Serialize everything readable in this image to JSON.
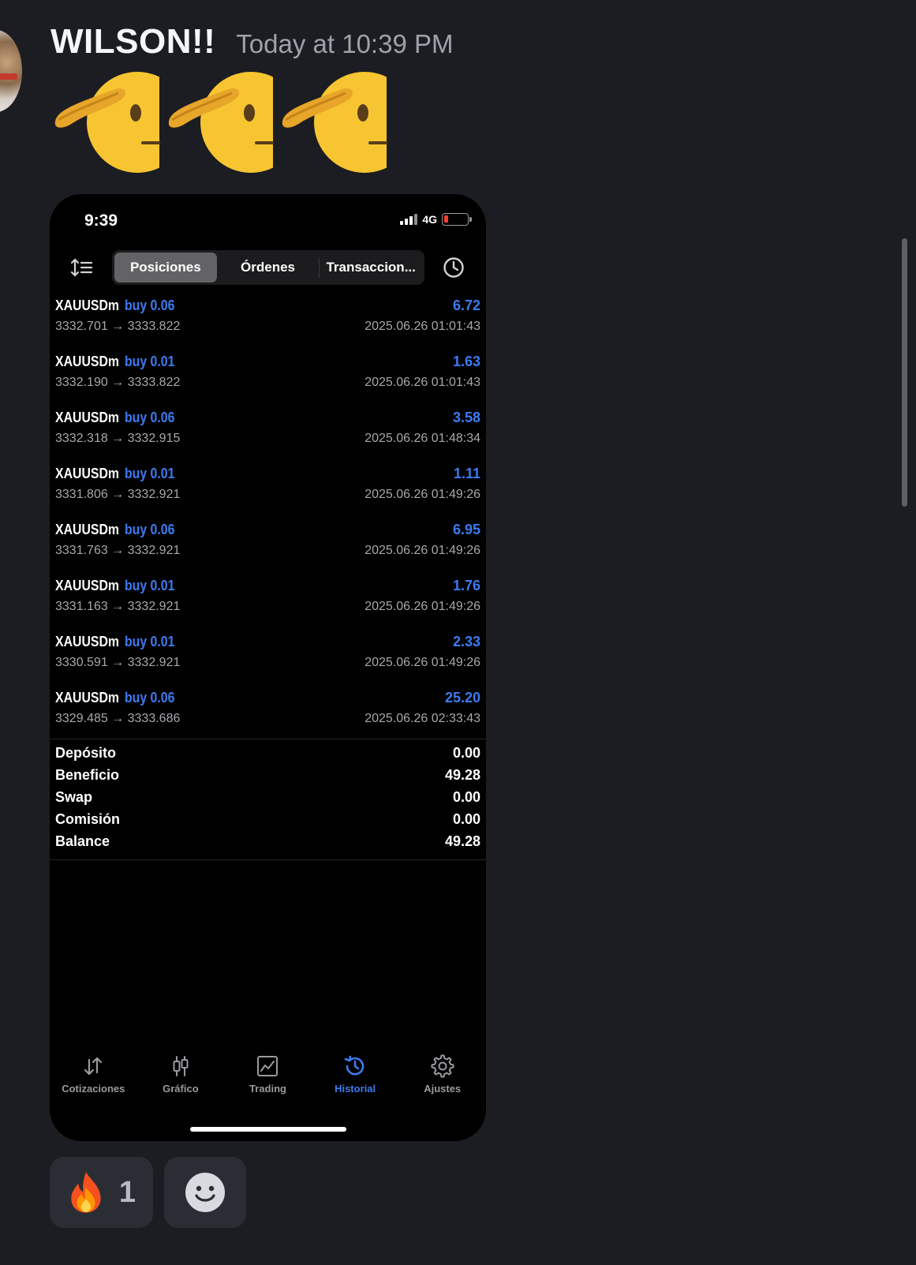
{
  "message": {
    "username": "WILSON!!",
    "timestamp": "Today at 10:39 PM",
    "emoji_count": 3
  },
  "phone": {
    "status_time": "9:39",
    "network": "4G",
    "segments": [
      "Posiciones",
      "Órdenes",
      "Transaccion..."
    ],
    "active_segment": "Posiciones",
    "trades": [
      {
        "symbol": "XAUUSDm",
        "side": "buy 0.06",
        "profit": "6.72",
        "prices": "3332.701 → 3333.822",
        "date": "2025.06.26 01:01:43"
      },
      {
        "symbol": "XAUUSDm",
        "side": "buy 0.01",
        "profit": "1.63",
        "prices": "3332.190 → 3333.822",
        "date": "2025.06.26 01:01:43"
      },
      {
        "symbol": "XAUUSDm",
        "side": "buy 0.06",
        "profit": "3.58",
        "prices": "3332.318 → 3332.915",
        "date": "2025.06.26 01:48:34"
      },
      {
        "symbol": "XAUUSDm",
        "side": "buy 0.01",
        "profit": "1.11",
        "prices": "3331.806 → 3332.921",
        "date": "2025.06.26 01:49:26"
      },
      {
        "symbol": "XAUUSDm",
        "side": "buy 0.06",
        "profit": "6.95",
        "prices": "3331.763 → 3332.921",
        "date": "2025.06.26 01:49:26"
      },
      {
        "symbol": "XAUUSDm",
        "side": "buy 0.01",
        "profit": "1.76",
        "prices": "3331.163 → 3332.921",
        "date": "2025.06.26 01:49:26"
      },
      {
        "symbol": "XAUUSDm",
        "side": "buy 0.01",
        "profit": "2.33",
        "prices": "3330.591 → 3332.921",
        "date": "2025.06.26 01:49:26"
      },
      {
        "symbol": "XAUUSDm",
        "side": "buy 0.06",
        "profit": "25.20",
        "prices": "3329.485 → 3333.686",
        "date": "2025.06.26 02:33:43"
      }
    ],
    "summary": [
      {
        "label": "Depósito",
        "value": "0.00"
      },
      {
        "label": "Beneficio",
        "value": "49.28"
      },
      {
        "label": "Swap",
        "value": "0.00"
      },
      {
        "label": "Comisión",
        "value": "0.00"
      },
      {
        "label": "Balance",
        "value": "49.28"
      }
    ],
    "tabs": [
      {
        "label": "Cotizaciones",
        "icon": "arrows-updown-icon"
      },
      {
        "label": "Gráfico",
        "icon": "candlestick-icon"
      },
      {
        "label": "Trading",
        "icon": "line-chart-icon"
      },
      {
        "label": "Historial",
        "icon": "history-clock-icon"
      },
      {
        "label": "Ajustes",
        "icon": "gear-icon"
      }
    ],
    "active_tab": "Historial",
    "accent_color": "#3d7bf0"
  },
  "reactions": [
    {
      "emoji": "fire",
      "count": "1"
    },
    {
      "emoji": "add-reaction",
      "count": ""
    }
  ]
}
